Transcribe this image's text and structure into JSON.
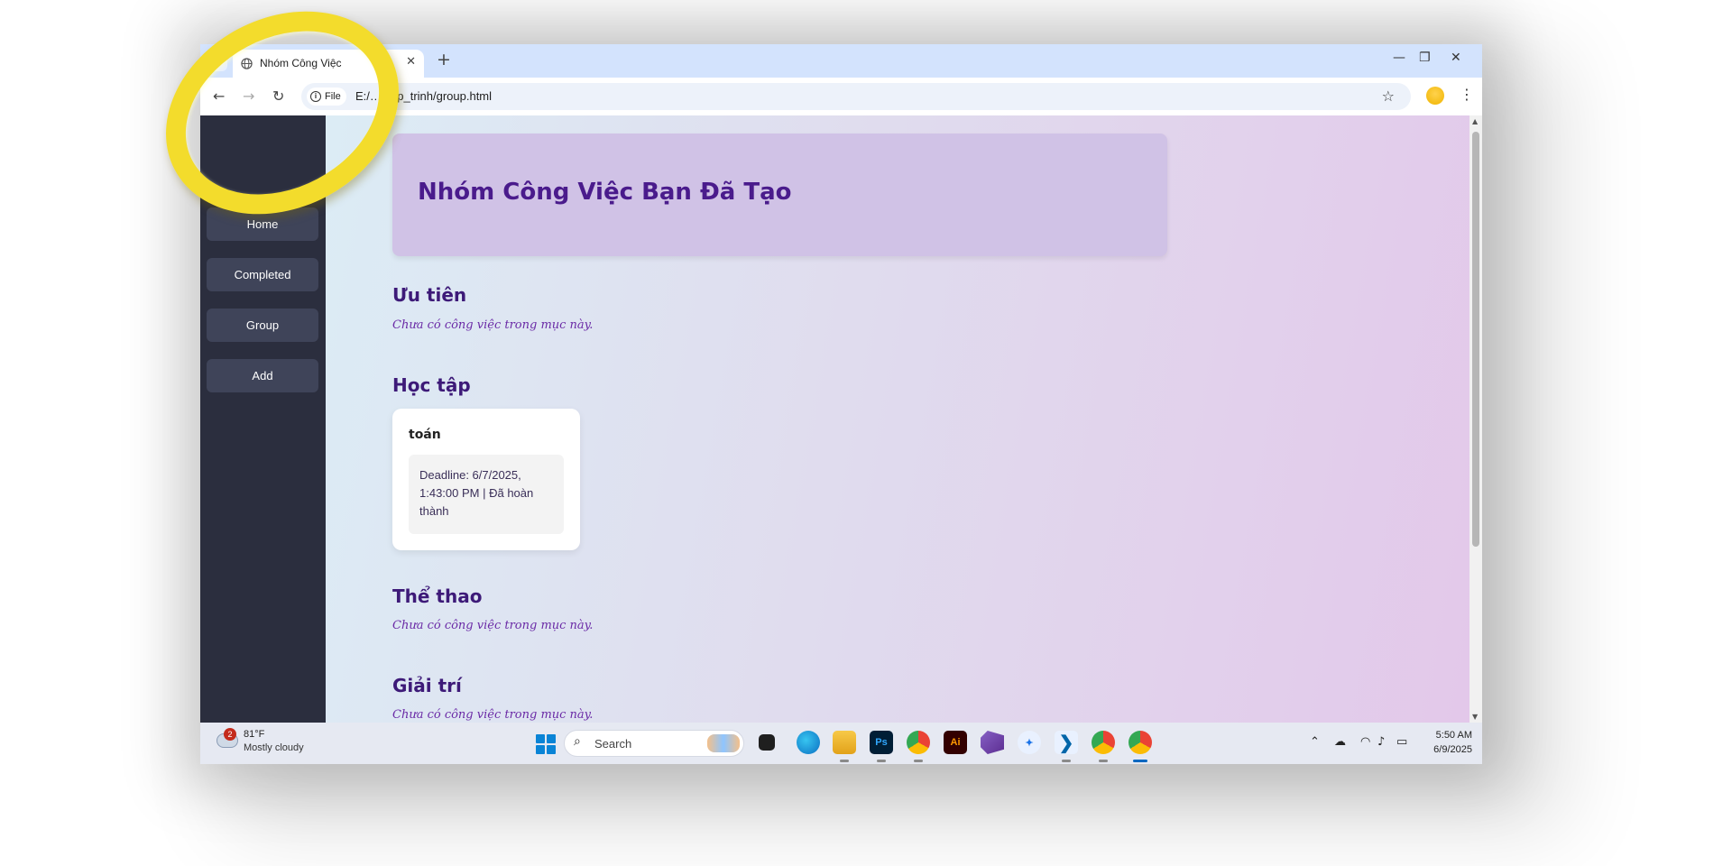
{
  "browser": {
    "tab_title": "Nhóm Công Việc",
    "new_tab_symbol": "+",
    "file_chip_label": "File",
    "url": "E:/…_lap_trinh/group.html"
  },
  "sidebar": {
    "items": [
      {
        "label": "Home"
      },
      {
        "label": "Completed"
      },
      {
        "label": "Group"
      },
      {
        "label": "Add"
      }
    ]
  },
  "main": {
    "header_title": "Nhóm Công Việc Bạn Đã Tạo",
    "sections": [
      {
        "title": "Ưu tiên",
        "empty_text": "Chưa có công việc trong mục này."
      },
      {
        "title": "Học tập",
        "tasks": [
          {
            "name": "toán",
            "detail": "Deadline: 6/7/2025, 1:43:00 PM | Đã hoàn thành"
          }
        ]
      },
      {
        "title": "Thể thao",
        "empty_text": "Chưa có công việc trong mục này."
      },
      {
        "title": "Giải trí",
        "empty_text": "Chưa có công việc trong mục này."
      }
    ]
  },
  "taskbar": {
    "weather_badge": "2",
    "weather_temp": "81°F",
    "weather_desc": "Mostly cloudy",
    "search_placeholder": "Search",
    "apps": [
      "file-explorer-icon",
      "edge-icon",
      "folder-icon",
      "photoshop-icon",
      "chrome-profile-icon",
      "illustrator-icon",
      "visual-studio-icon",
      "app-store-icon",
      "vscode-icon",
      "chrome-profile-2-icon",
      "chrome-icon"
    ],
    "photoshop_label": "Ps",
    "illustrator_label": "Ai",
    "clock_time": "5:50 AM",
    "clock_date": "6/9/2025"
  },
  "colors": {
    "sidebar_bg": "#2b2e3e",
    "sidebar_button": "#3f4459",
    "heading": "#4a1b8c",
    "empty_note": "#6a2aa6",
    "ring": "#f3dc2c"
  }
}
